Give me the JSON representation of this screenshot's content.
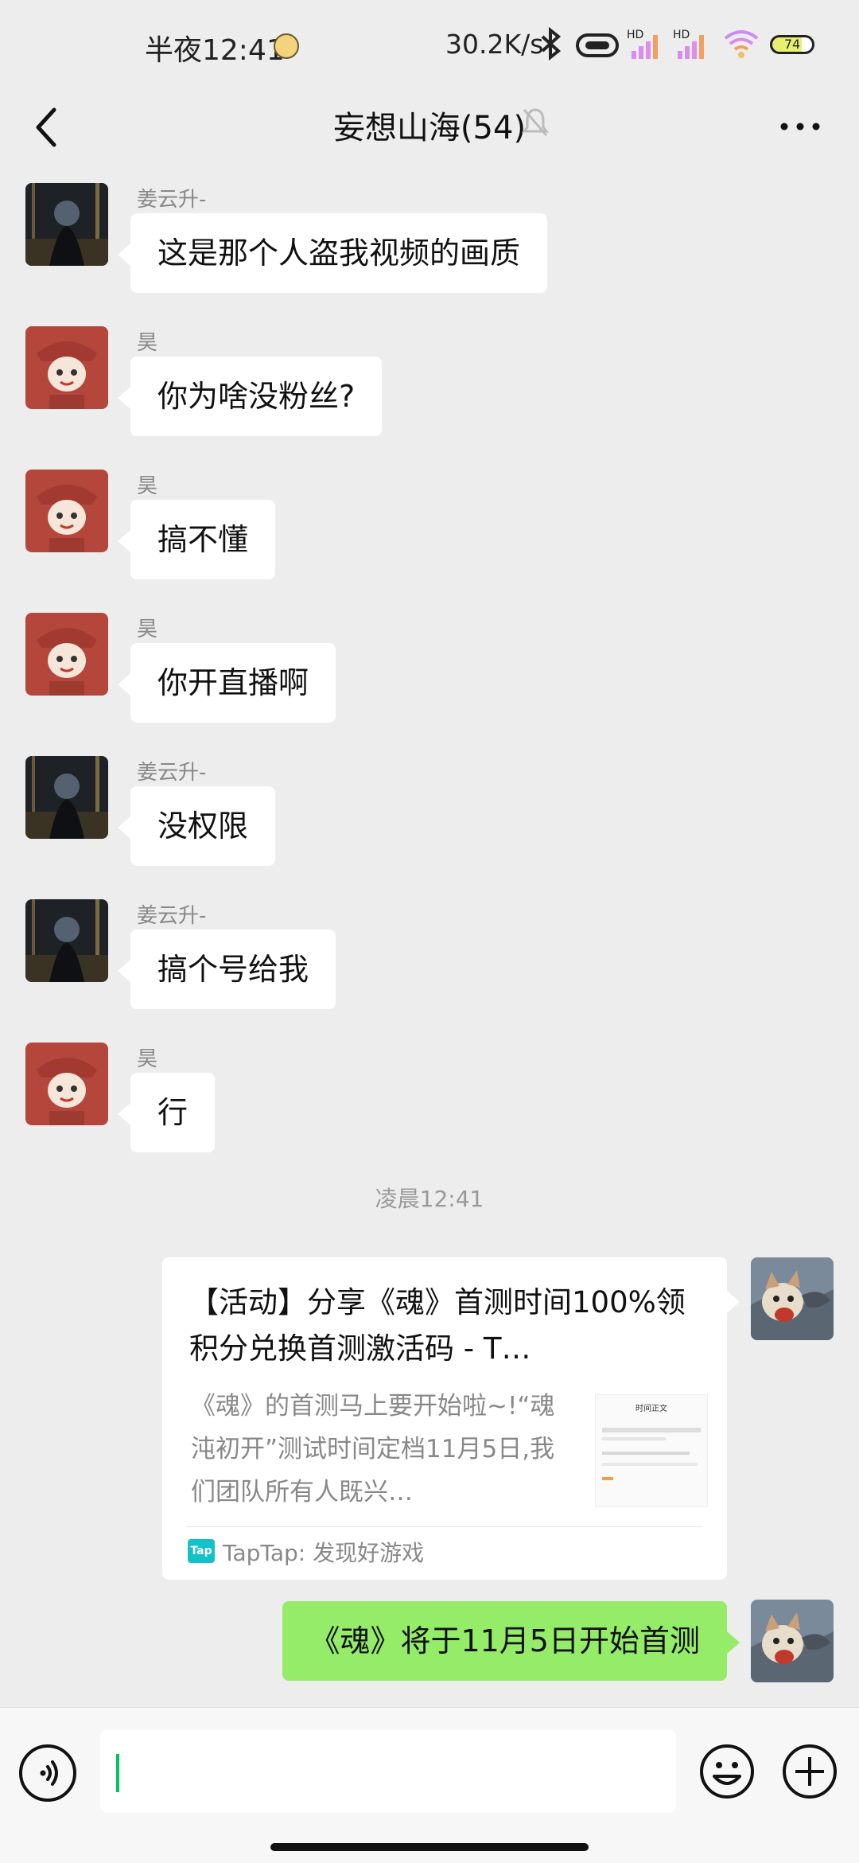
{
  "status_bar": {
    "time": "半夜12:41",
    "net_speed": "30.2K/s",
    "battery": "74"
  },
  "header": {
    "title": "妄想山海(54)"
  },
  "messages": [
    {
      "sender": "姜云升-",
      "text": "这是那个人盗我视频的画质",
      "avatar": "jiang"
    },
    {
      "sender": "昊",
      "text": "你为啥没粉丝?",
      "avatar": "hao"
    },
    {
      "sender": "昊",
      "text": "搞不懂",
      "avatar": "hao"
    },
    {
      "sender": "昊",
      "text": "你开直播啊",
      "avatar": "hao"
    },
    {
      "sender": "姜云升-",
      "text": "没权限",
      "avatar": "jiang"
    },
    {
      "sender": "姜云升-",
      "text": "搞个号给我",
      "avatar": "jiang"
    },
    {
      "sender": "昊",
      "text": "行",
      "avatar": "hao"
    }
  ],
  "timestamp": "凌晨12:41",
  "link_card": {
    "title": "【活动】分享《魂》首测时间100%领积分兑换首测激活码 - T…",
    "description": "《魂》的首测马上要开始啦~!“魂沌初开”测试时间定档11月5日,我们团队所有人既兴…",
    "source": "TapTap: 发现好游戏",
    "source_icon_text": "Tap",
    "thumb_header": "时间正文"
  },
  "my_message": "《魂》将于11月5日开始首测",
  "colors": {
    "background": "#EDEDED",
    "my_bubble": "#95EC69",
    "cursor": "#07C160",
    "taptap": "#13C1C9"
  }
}
